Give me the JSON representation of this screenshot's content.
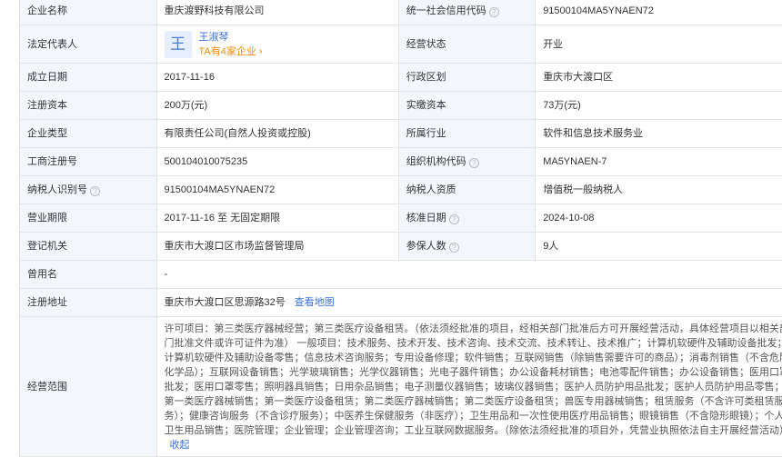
{
  "rows": {
    "name": {
      "label": "企业名称",
      "value": "重庆渡野科技有限公司"
    },
    "credit": {
      "label": "统一社会信用代码",
      "value": "91500104MA5YNAEN72"
    },
    "rep": {
      "label": "法定代表人",
      "avatar_char": "王",
      "name": "王淑琴",
      "sub": "TA有4家企业 ›"
    },
    "status": {
      "label": "经营状态",
      "value": "开业"
    },
    "founded": {
      "label": "成立日期",
      "value": "2017-11-16"
    },
    "region": {
      "label": "行政区划",
      "value": "重庆市大渡口区"
    },
    "capital": {
      "label": "注册资本",
      "value": "200万(元)"
    },
    "paid": {
      "label": "实缴资本",
      "value": "73万(元)"
    },
    "type": {
      "label": "企业类型",
      "value": "有限责任公司(自然人投资或控股)"
    },
    "industry": {
      "label": "所属行业",
      "value": "软件和信息技术服务业"
    },
    "regno": {
      "label": "工商注册号",
      "value": "500104010075235"
    },
    "orgcode": {
      "label": "组织机构代码",
      "value": "MA5YNAEN-7"
    },
    "taxid": {
      "label": "纳税人识别号",
      "value": "91500104MA5YNAEN72"
    },
    "taxqual": {
      "label": "纳税人资质",
      "value": "增值税一般纳税人"
    },
    "period": {
      "label": "营业期限",
      "value": "2017-11-16 至 无固定期限"
    },
    "approve": {
      "label": "核准日期",
      "value": "2024-10-08"
    },
    "authority": {
      "label": "登记机关",
      "value": "重庆市大渡口区市场监督管理局"
    },
    "insured": {
      "label": "参保人数",
      "value": "9人"
    },
    "former": {
      "label": "曾用名",
      "value": "-"
    },
    "address": {
      "label": "注册地址",
      "value": "重庆市大渡口区思源路32号",
      "link": "查看地图"
    },
    "scope": {
      "label": "经营范围",
      "value": "许可项目：第三类医疗器械经营；第三类医疗设备租赁。（依法须经批准的项目，经相关部门批准后方可开展经营活动，具体经营项目以相关部门批准文件或许可证件为准） 一般项目：技术服务、技术开发、技术咨询、技术交流、技术转让、技术推广；计算机软硬件及辅助设备批发；计算机软硬件及辅助设备零售；信息技术咨询服务；专用设备修理；软件销售；互联网销售（除销售需要许可的商品）；消毒剂销售（不含危险化学品）；互联网设备销售；光学玻璃销售；光学仪器销售；光电子器件销售；办公设备耗材销售；电池零配件销售；办公设备销售；医用口罩批发；医用口罩零售；照明器具销售；日用杂品销售；电子测量仪器销售；玻璃仪器销售；医护人员防护用品批发；医护人员防护用品零售；第一类医疗器械销售；第一类医疗设备租赁；第二类医疗器械销售；第二类医疗设备租赁；兽医专用器械销售；租赁服务（不含许可类租赁服务）；健康咨询服务（不含诊疗服务）；中医养生保健服务（非医疗）；卫生用品和一次性使用医疗用品销售；眼镜销售（不含隐形眼镜）；个人卫生用品销售；医院管理；企业管理；企业管理咨询；工业互联网数据服务。（除依法须经批准的项目外，凭营业执照依法自主开展经营活动）",
      "fold": "收起"
    }
  },
  "help_icon": "?"
}
